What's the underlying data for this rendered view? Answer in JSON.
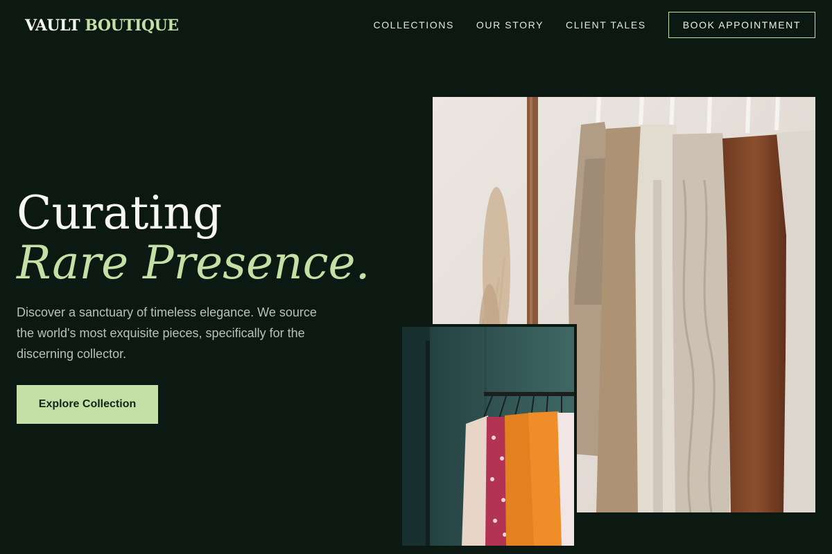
{
  "brand": {
    "name_part1": "VAULT",
    "name_part2": "BOUTIQUE"
  },
  "nav": {
    "links": [
      "COLLECTIONS",
      "OUR STORY",
      "CLIENT TALES"
    ],
    "cta": "BOOK APPOINTMENT"
  },
  "hero": {
    "title_line1": "Curating",
    "title_line2": "Rare Presence.",
    "description": "Discover a sanctuary of timeless elegance. We source the world's most exquisite pieces, specifically for the discerning collector.",
    "cta": "Explore Collection"
  },
  "colors": {
    "background": "#0c1812",
    "accent": "#c5e0a5",
    "text": "#e8ede6"
  }
}
